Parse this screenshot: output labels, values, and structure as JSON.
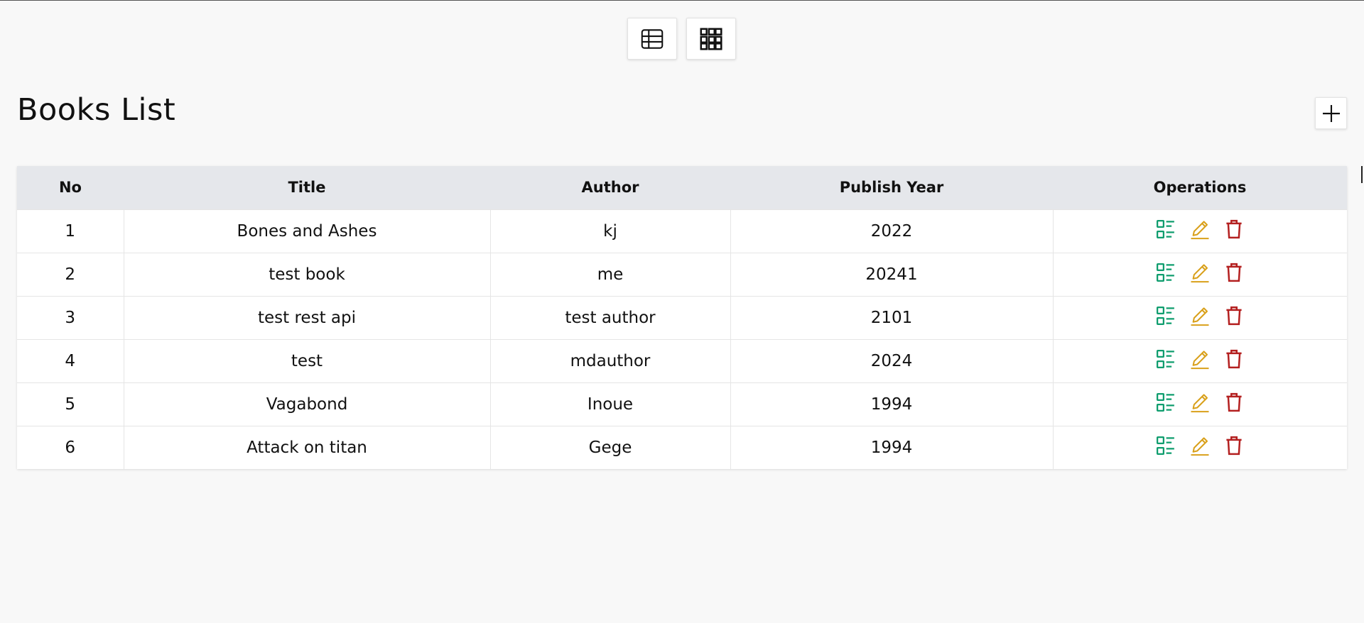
{
  "view_toggle": {
    "table_view_icon": "table-icon",
    "card_view_icon": "grid-icon"
  },
  "page": {
    "title": "Books List",
    "add_icon": "plus-icon"
  },
  "table": {
    "headers": [
      "No",
      "Title",
      "Author",
      "Publish Year",
      "Operations"
    ],
    "rows": [
      {
        "no": "1",
        "title": "Bones and Ashes",
        "author": "kj",
        "year": "2022"
      },
      {
        "no": "2",
        "title": "test book",
        "author": "me",
        "year": "20241"
      },
      {
        "no": "3",
        "title": "test rest api",
        "author": "test author",
        "year": "2101"
      },
      {
        "no": "4",
        "title": "test",
        "author": "mdauthor",
        "year": "2024"
      },
      {
        "no": "5",
        "title": "Vagabond",
        "author": "Inoue",
        "year": "1994"
      },
      {
        "no": "6",
        "title": "Attack on titan",
        "author": "Gege",
        "year": "1994"
      }
    ],
    "operation_icons": [
      "details-icon",
      "edit-icon",
      "delete-icon"
    ]
  },
  "colors": {
    "details": "#0f9d6e",
    "edit": "#d9a01a",
    "delete": "#b42020",
    "header_bg": "#e5e7eb",
    "page_bg": "#f8f8f8"
  }
}
